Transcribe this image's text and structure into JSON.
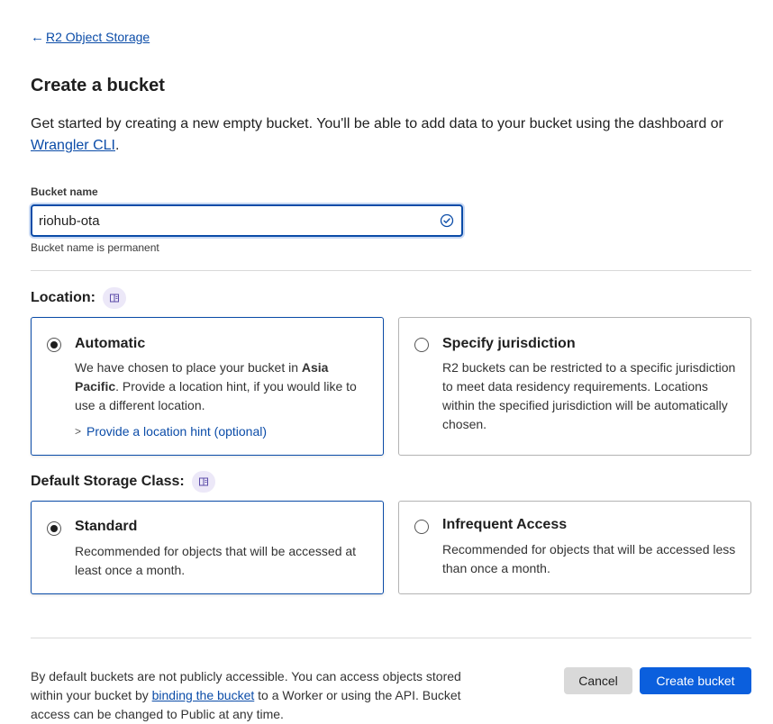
{
  "breadcrumb": {
    "arrow": "←",
    "label": "R2 Object Storage"
  },
  "page": {
    "title": "Create a bucket",
    "intro_text": "Get started by creating a new empty bucket. You'll be able to add data to your bucket using the dashboard or ",
    "intro_link": "Wrangler CLI",
    "intro_end": "."
  },
  "bucket_name": {
    "label": "Bucket name",
    "value": "riohub-ota",
    "help": "Bucket name is permanent",
    "status_icon": "check-circle-icon"
  },
  "location": {
    "label": "Location:",
    "doc_icon": "book-icon",
    "options": [
      {
        "title": "Automatic",
        "selected": true,
        "desc_pre": "We have chosen to place your bucket in ",
        "desc_bold": "Asia Pacific",
        "desc_post": ". Provide a location hint, if you would like to use a different location.",
        "hint_link": "Provide a location hint (optional)"
      },
      {
        "title": "Specify jurisdiction",
        "selected": false,
        "desc": "R2 buckets can be restricted to a specific jurisdiction to meet data residency requirements. Locations within the specified jurisdiction will be automatically chosen."
      }
    ]
  },
  "storage_class": {
    "label": "Default Storage Class:",
    "doc_icon": "book-icon",
    "options": [
      {
        "title": "Standard",
        "selected": true,
        "desc": "Recommended for objects that will be accessed at least once a month."
      },
      {
        "title": "Infrequent Access",
        "selected": false,
        "desc": "Recommended for objects that will be accessed less than once a month."
      }
    ]
  },
  "footer": {
    "note_pre": "By default buckets are not publicly accessible. You can access objects stored within your bucket by ",
    "note_link": "binding the bucket",
    "note_post": " to a Worker or using the API. Bucket access can be changed to Public at any time.",
    "cancel_label": "Cancel",
    "create_label": "Create bucket"
  },
  "colors": {
    "accent": "#0b5fdd",
    "link": "#0b4ca8",
    "badge_bg": "#ece8f8"
  }
}
